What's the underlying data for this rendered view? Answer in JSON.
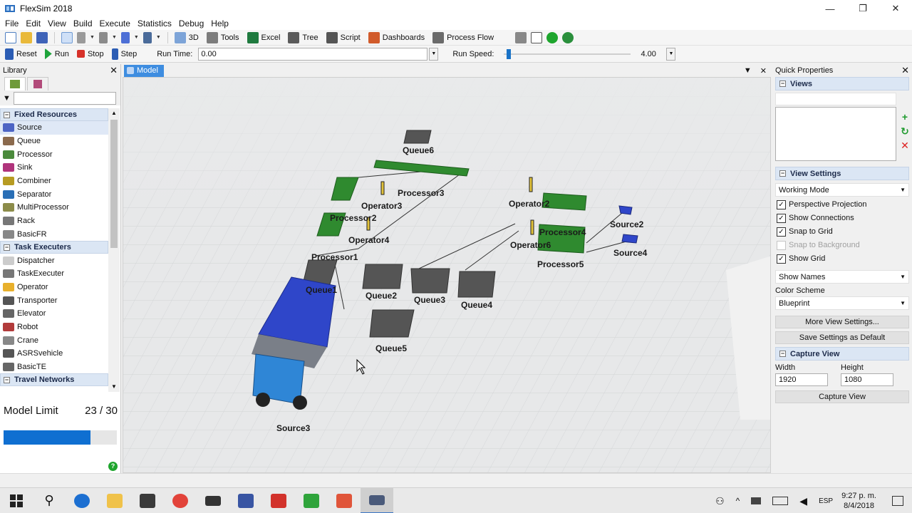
{
  "window": {
    "title": "FlexSim 2018",
    "controls": [
      "—",
      "❐",
      "✕"
    ]
  },
  "menu": [
    "File",
    "Edit",
    "View",
    "Build",
    "Execute",
    "Statistics",
    "Debug",
    "Help"
  ],
  "toolbar1": {
    "view3d": "3D",
    "tools": "Tools",
    "excel": "Excel",
    "tree": "Tree",
    "script": "Script",
    "dashboards": "Dashboards",
    "process_flow": "Process Flow"
  },
  "toolbar2": {
    "reset": "Reset",
    "run": "Run",
    "stop": "Stop",
    "step": "Step",
    "run_time_label": "Run Time:",
    "run_time_value": "0.00",
    "run_speed_label": "Run Speed:",
    "run_speed_value": "4.00",
    "run_speed_fraction": 0.02
  },
  "library": {
    "title": "Library",
    "categories": [
      {
        "label": "Fixed Resources",
        "items": [
          "Source",
          "Queue",
          "Processor",
          "Sink",
          "Combiner",
          "Separator",
          "MultiProcessor",
          "Rack",
          "BasicFR"
        ]
      },
      {
        "label": "Task Executers",
        "items": [
          "Dispatcher",
          "TaskExecuter",
          "Operator",
          "Transporter",
          "Elevator",
          "Robot",
          "Crane",
          "ASRSvehicle",
          "BasicTE"
        ]
      },
      {
        "label": "Travel Networks",
        "items": []
      }
    ],
    "selected_item": "Source",
    "model_limit_label": "Model Limit",
    "model_limit_value": "23 / 30",
    "model_limit_fraction": 0.7667
  },
  "model": {
    "tab_label": "Model",
    "objects": [
      "Queue6",
      "Processor3",
      "Operator3",
      "Processor2",
      "Operator4",
      "Processor1",
      "Queue1",
      "Queue2",
      "Queue3",
      "Queue4",
      "Queue5",
      "Operator2",
      "Processor4",
      "Operator6",
      "Processor5",
      "Source2",
      "Source4",
      "Source3"
    ]
  },
  "quick_properties": {
    "title": "Quick Properties",
    "views_section": "Views",
    "view_settings_section": "View Settings",
    "working_mode": "Working Mode",
    "checks": [
      {
        "label": "Perspective Projection",
        "checked": true,
        "disabled": false
      },
      {
        "label": "Show Connections",
        "checked": true,
        "disabled": false
      },
      {
        "label": "Snap to Grid",
        "checked": true,
        "disabled": false
      },
      {
        "label": "Snap to Background",
        "checked": false,
        "disabled": true
      },
      {
        "label": "Show Grid",
        "checked": true,
        "disabled": false
      }
    ],
    "show_names": "Show Names",
    "color_scheme_label": "Color Scheme",
    "color_scheme_value": "Blueprint",
    "more_view_settings": "More View Settings...",
    "save_default": "Save Settings as Default",
    "capture_section": "Capture View",
    "width_label": "Width",
    "width_value": "1920",
    "height_label": "Height",
    "height_value": "1080",
    "capture_button": "Capture View"
  },
  "taskbar": {
    "lang": "ESP",
    "time": "9:27 p. m.",
    "date": "8/4/2018"
  },
  "colors": {
    "accent": "#3e8de0",
    "progress": "#0f6fd1",
    "queue": "#5a5a5a",
    "processor": "#2f8a2f",
    "source_truck": "#2f46c9"
  }
}
